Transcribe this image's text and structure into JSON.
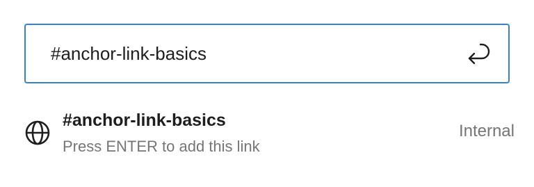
{
  "link_control": {
    "input_value": "#anchor-link-basics",
    "submit_icon": "enter-return-icon",
    "accent_color": "#3582c4"
  },
  "suggestion": {
    "icon": "globe-icon",
    "title": "#anchor-link-basics",
    "info": "Press ENTER to add this link",
    "type": "Internal"
  }
}
